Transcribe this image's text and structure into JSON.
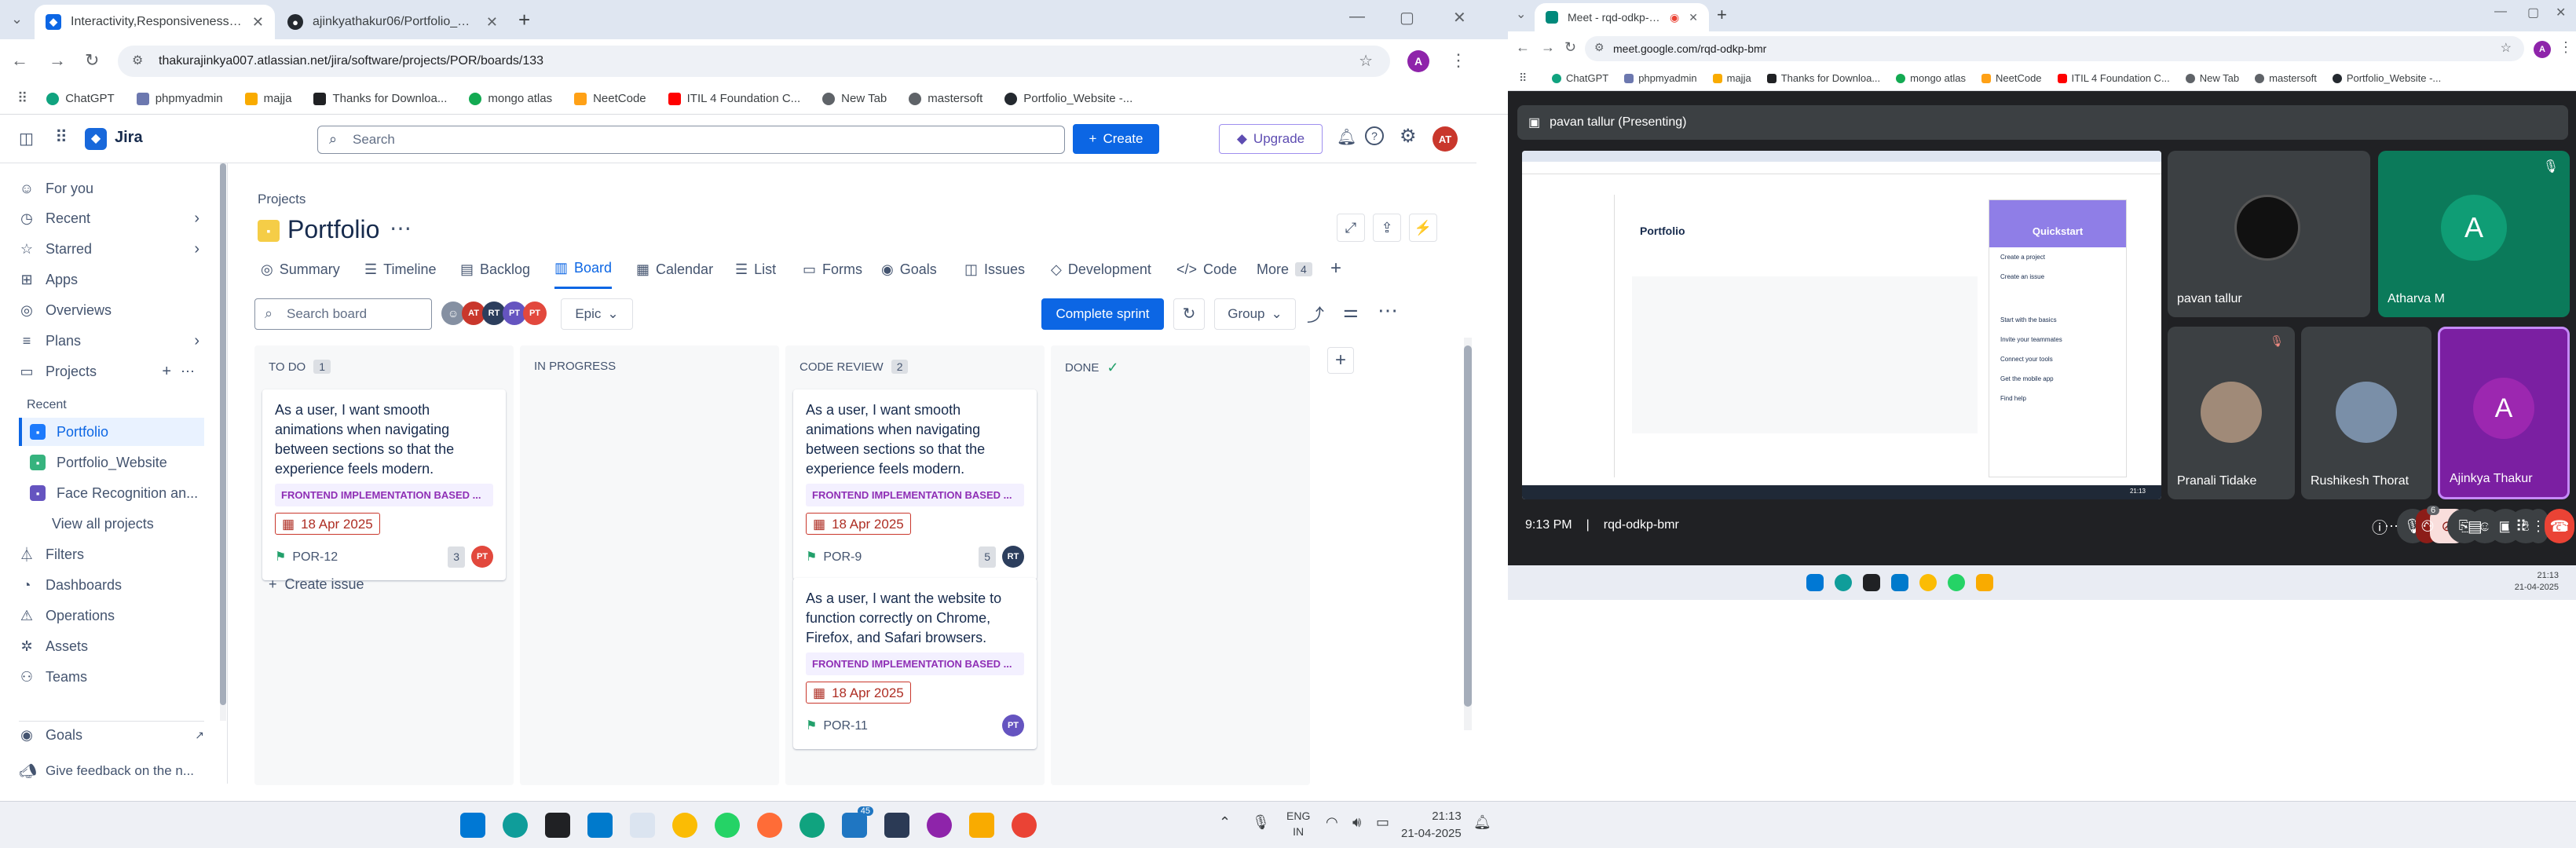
{
  "left_browser": {
    "tabs": [
      {
        "title": "Interactivity,Responsiveness - P",
        "active": true
      },
      {
        "title": "ajinkyathakur06/Portfolio_Webs",
        "active": false
      }
    ],
    "new_tab": "+",
    "url": "thakurajinkya007.atlassian.net/jira/software/projects/POR/boards/133",
    "profile": "A",
    "bookmarks": [
      "ChatGPT",
      "phpmyadmin",
      "majja",
      "Thanks for Downloa...",
      "mongo atlas",
      "NeetCode",
      "ITIL 4 Foundation C...",
      "New Tab",
      "mastersoft",
      "Portfolio_Website -..."
    ]
  },
  "jira": {
    "app_name": "Jira",
    "search_placeholder": "Search",
    "create_label": "Create",
    "upgrade_label": "Upgrade",
    "user_initials": "AT",
    "sidebar": {
      "items": [
        {
          "label": "For you",
          "icon": "user-icon"
        },
        {
          "label": "Recent",
          "icon": "clock-icon",
          "chevron": true
        },
        {
          "label": "Starred",
          "icon": "star-icon",
          "chevron": true
        },
        {
          "label": "Apps",
          "icon": "apps-icon"
        },
        {
          "label": "Overviews",
          "icon": "globe-icon"
        },
        {
          "label": "Plans",
          "icon": "plans-icon",
          "chevron": true
        },
        {
          "label": "Projects",
          "icon": "projects-icon"
        }
      ],
      "recent_label": "Recent",
      "projects": [
        "Portfolio",
        "Portfolio_Website",
        "Face Recognition an...",
        "View all projects"
      ],
      "bottom_items": [
        "Filters",
        "Dashboards",
        "Operations",
        "Assets",
        "Teams"
      ],
      "goals": "Goals",
      "feedback": "Give feedback on the n..."
    },
    "breadcrumb": "Projects",
    "project_title": "Portfolio",
    "tabs": [
      "Summary",
      "Timeline",
      "Backlog",
      "Board",
      "Calendar",
      "List",
      "Forms",
      "Goals",
      "Issues",
      "Development",
      "Code",
      "More"
    ],
    "active_tab": "Board",
    "more_count": "4",
    "board_search": "Search board",
    "avatars": [
      "AT",
      "RT",
      "PT",
      "PT"
    ],
    "epic_filter": "Epic",
    "complete_sprint": "Complete sprint",
    "group_label": "Group",
    "columns": [
      {
        "title": "TO DO",
        "count": "1",
        "cards": [
          {
            "text": "As a user, I want smooth animations when navigating between sections so that the experience feels modern.",
            "epic": "FRONTEND IMPLEMENTATION BASED ...",
            "date": "18 Apr 2025",
            "key": "POR-12",
            "points": "3",
            "assignee": "PT"
          }
        ],
        "create": "Create issue"
      },
      {
        "title": "IN PROGRESS",
        "count": "",
        "cards": []
      },
      {
        "title": "CODE REVIEW",
        "count": "2",
        "cards": [
          {
            "text": "As a user, I want smooth animations when navigating between sections so that the experience feels modern.",
            "epic": "FRONTEND IMPLEMENTATION BASED ...",
            "date": "18 Apr 2025",
            "key": "POR-9",
            "points": "5",
            "assignee": "RT"
          },
          {
            "text": "As a user, I want the website to function correctly on Chrome, Firefox, and Safari browsers.",
            "epic": "FRONTEND IMPLEMENTATION BASED ...",
            "date": "18 Apr 2025",
            "key": "POR-11",
            "points": "",
            "assignee": "PT"
          }
        ]
      },
      {
        "title": "DONE",
        "count": "",
        "done": true,
        "cards": []
      }
    ]
  },
  "meet": {
    "tab_title": "Meet - rqd-odkp-bmr",
    "url": "meet.google.com/rqd-odkp-bmr",
    "presenter": "pavan tallur (Presenting)",
    "participants": [
      {
        "name": "pavan tallur"
      },
      {
        "name": "Atharva M",
        "initial": "A"
      },
      {
        "name": "Pranali Tidake"
      },
      {
        "name": "Rushikesh Thorat"
      },
      {
        "name": "Ajinkya Thakur",
        "initial": "A"
      }
    ],
    "time": "9:13 PM",
    "code": "rqd-odkp-bmr",
    "people_count": "6",
    "shared": {
      "quickstart": "Quickstart",
      "title": "Portfolio",
      "items": [
        "Create a project",
        "Create an issue",
        "Start with the basics",
        "Invite your teammates",
        "Connect your tools",
        "Get the mobile app",
        "Find help"
      ]
    },
    "inner_clock": {
      "time": "21:13",
      "date": "21-04-2025"
    }
  },
  "taskbar": {
    "lang": "ENG",
    "region": "IN",
    "time": "21:13",
    "date": "21-04-2025",
    "badge": "45"
  },
  "colors": {
    "jira_blue": "#0c66e4",
    "date_red": "#c9372c",
    "epic_purple": "#8f2fb5",
    "meet_bg": "#202124",
    "end_call": "#ea4335"
  }
}
